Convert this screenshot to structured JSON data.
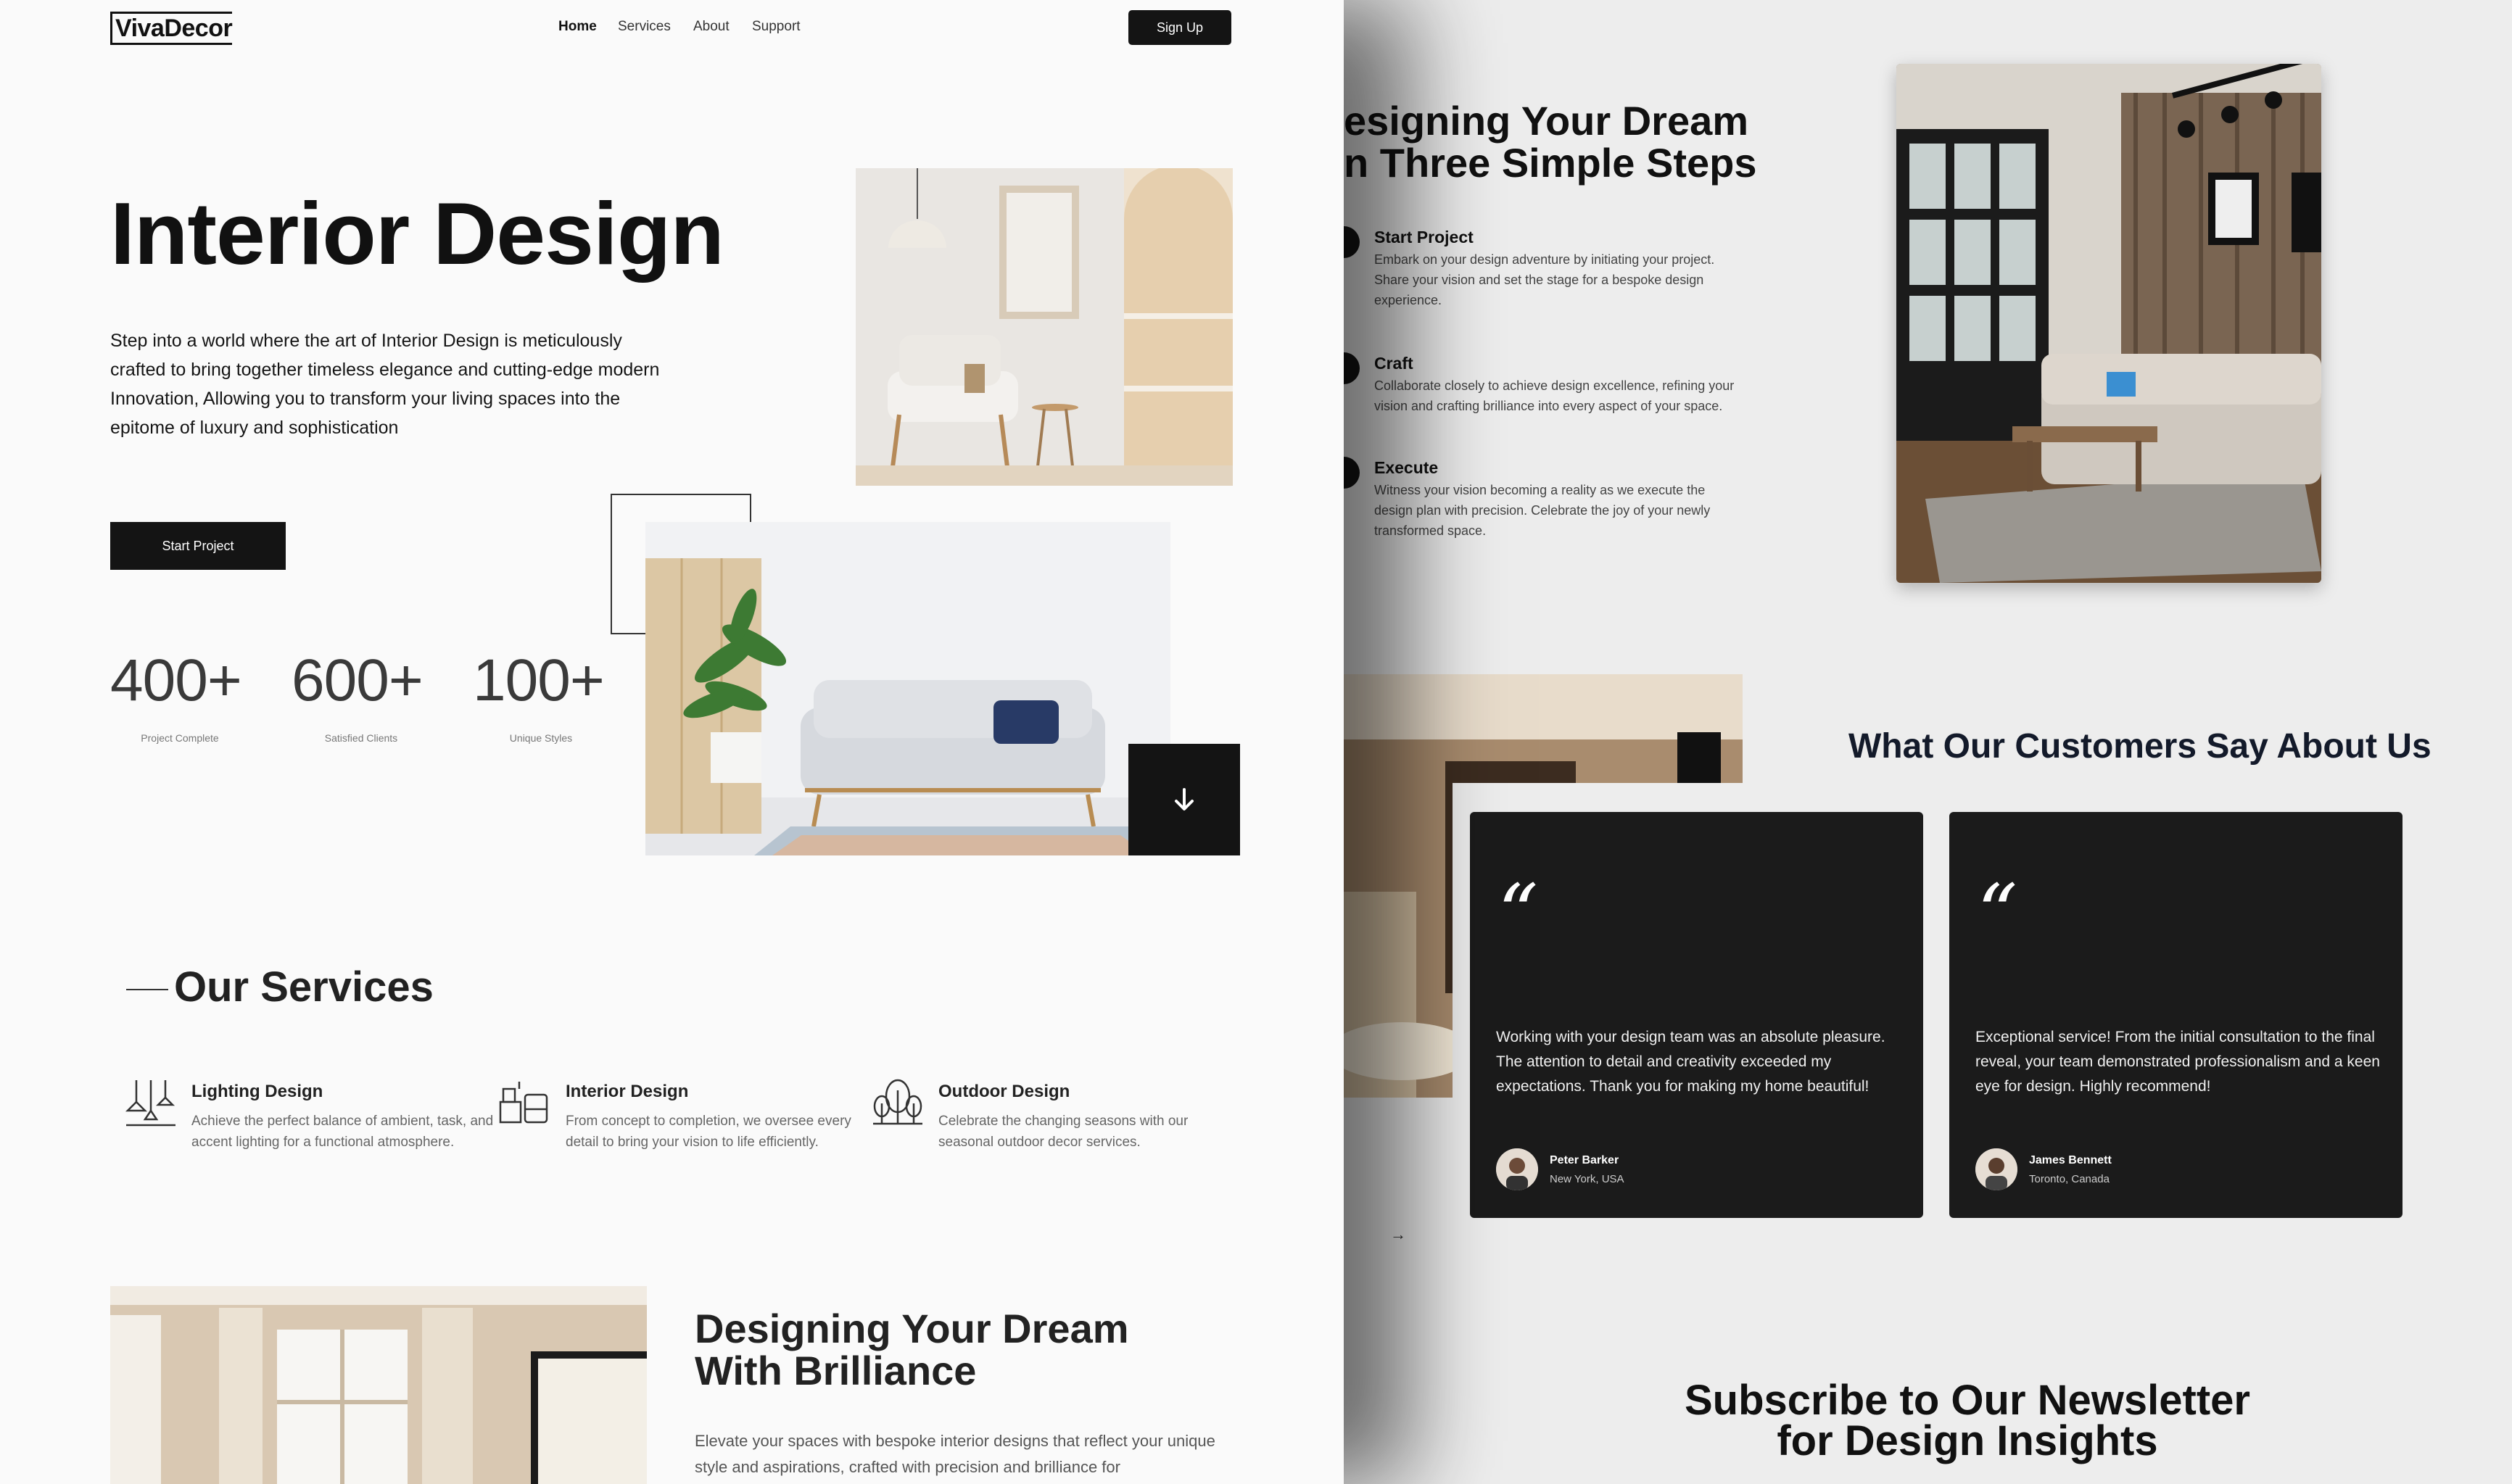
{
  "left_page": {
    "logo": "VivaDecor",
    "nav": [
      "Home",
      "Services",
      "About",
      "Support"
    ],
    "signup_label": "Sign Up",
    "hero": {
      "title": "Interior Design",
      "description": "Step into a world where the art of Interior Design is meticulously crafted to bring together timeless elegance and cutting-edge modern Innovation, Allowing you to transform your living spaces into the epitome of luxury and sophistication",
      "cta_label": "Start Project"
    },
    "stats": [
      {
        "value": "400+",
        "label": "Project Complete"
      },
      {
        "value": "600+",
        "label": "Satisfied Clients"
      },
      {
        "value": "100+",
        "label": "Unique Styles"
      }
    ],
    "services": {
      "title": "Our Services",
      "items": [
        {
          "title": "Lighting Design",
          "desc": "Achieve the perfect balance of ambient, task, and accent lighting for a functional atmosphere.",
          "icon": "pendant-lights-icon"
        },
        {
          "title": "Interior Design",
          "desc": "From concept to completion, we oversee every detail to bring your vision to life efficiently.",
          "icon": "furniture-icon"
        },
        {
          "title": "Outdoor Design",
          "desc": "Celebrate the changing seasons with our seasonal outdoor decor services.",
          "icon": "trees-icon"
        }
      ]
    },
    "brilliance": {
      "title_line1": "Designing Your Dream",
      "title_line2": "With Brilliance",
      "description": "Elevate your spaces with bespoke interior designs that reflect your unique style and aspirations, crafted with precision and brilliance for"
    }
  },
  "right_page": {
    "steps_title_line1": "esigning Your Dream",
    "steps_title_line2": "n Three Simple Steps",
    "steps": [
      {
        "title": "Start Project",
        "desc": "Embark on your design adventure by initiating your project. Share your vision and set the stage for a bespoke design experience."
      },
      {
        "title": "Craft",
        "desc": "Collaborate closely to achieve design excellence, refining your vision and crafting brilliance into every aspect of your space."
      },
      {
        "title": "Execute",
        "desc": "Witness your vision becoming a reality as we execute the design plan with precision. Celebrate the joy of your newly transformed space."
      }
    ],
    "testimonials_title": "What Our Customers Say About Us",
    "testimonials": [
      {
        "quote": "Working with your design team was an absolute pleasure. The attention to detail and creativity exceeded my expectations. Thank you for making my home beautiful!",
        "name": "Peter Barker",
        "location": "New York, USA"
      },
      {
        "quote": "Exceptional service! From the initial consultation to the final reveal, your team demonstrated professionalism and a keen eye for design. Highly recommend!",
        "name": "James Bennett",
        "location": "Toronto, Canada"
      }
    ],
    "newsletter_line1": "Subscribe to Our Newsletter",
    "newsletter_line2": "for Design Insights"
  },
  "colors": {
    "accent_dark": "#141414",
    "page_left": "#fafafa",
    "page_right": "#ededed",
    "card": "#1b1b1b"
  }
}
